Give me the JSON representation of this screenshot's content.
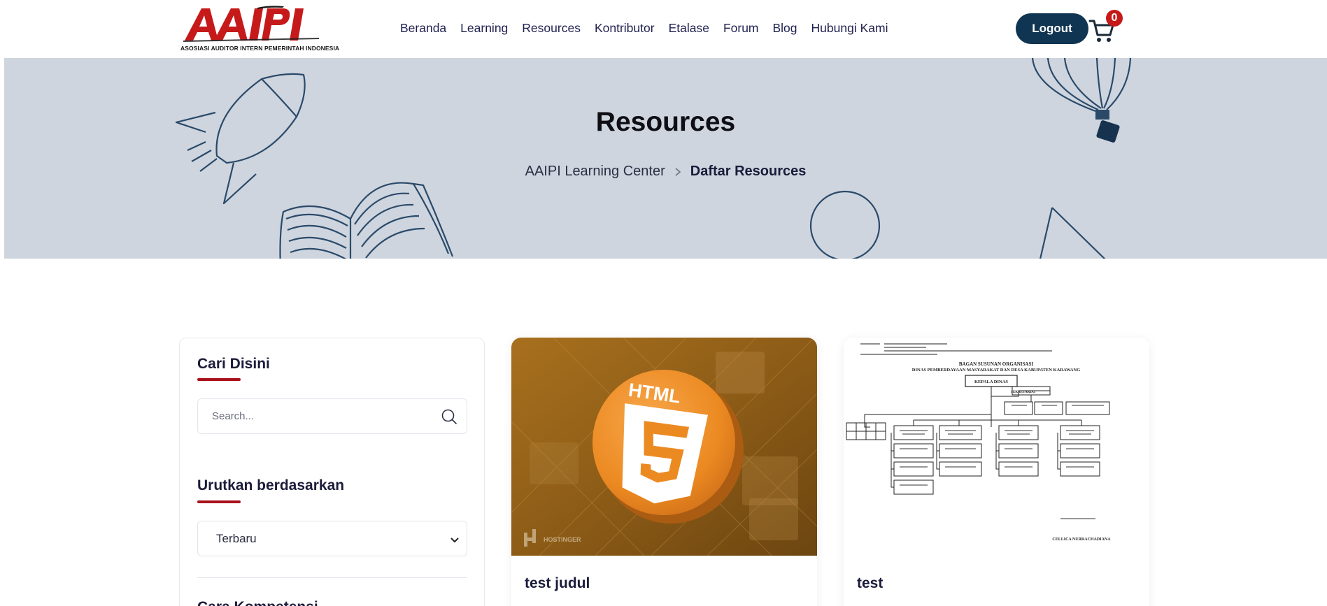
{
  "header": {
    "logo_text": "AAIPI",
    "logo_subtitle": "ASOSIASI AUDITOR INTERN PEMERINTAH INDONESIA",
    "nav": [
      {
        "label": "Beranda"
      },
      {
        "label": "Learning"
      },
      {
        "label": "Resources"
      },
      {
        "label": "Kontributor"
      },
      {
        "label": "Etalase"
      },
      {
        "label": "Forum"
      },
      {
        "label": "Blog"
      },
      {
        "label": "Hubungi Kami"
      }
    ],
    "logout_label": "Logout",
    "cart_count": "0",
    "brand_color": "#c61a1a",
    "button_color": "#0f3552"
  },
  "hero": {
    "title": "Resources",
    "breadcrumb_home": "AAIPI Learning Center",
    "breadcrumb_current": "Daftar Resources",
    "background_color": "#ced5de"
  },
  "sidebar": {
    "search_title": "Cari Disini",
    "search_placeholder": "Search...",
    "sort_title": "Urutkan berdasarkan",
    "sort_value": "Terbaru",
    "competency_title": "Cara Kompetensi",
    "accent_color": "#a8121c"
  },
  "cards": [
    {
      "title": "test judul",
      "image": "html5-thumbnail",
      "watermark": "HOSTINGER"
    },
    {
      "title": "test",
      "image": "org-chart-document",
      "doc_heading": "BAGAN SUSUNAN ORGANISASI",
      "doc_subheading": "DINAS PEMBERDAYAAN MASYARAKAT DAN DESA KABUPATEN KARAWANG",
      "doc_top_box": "KEPALA DINAS",
      "doc_secretariat": "SEKRETARIAT",
      "doc_signer": "CELLICA NURRACHADIANA"
    }
  ]
}
